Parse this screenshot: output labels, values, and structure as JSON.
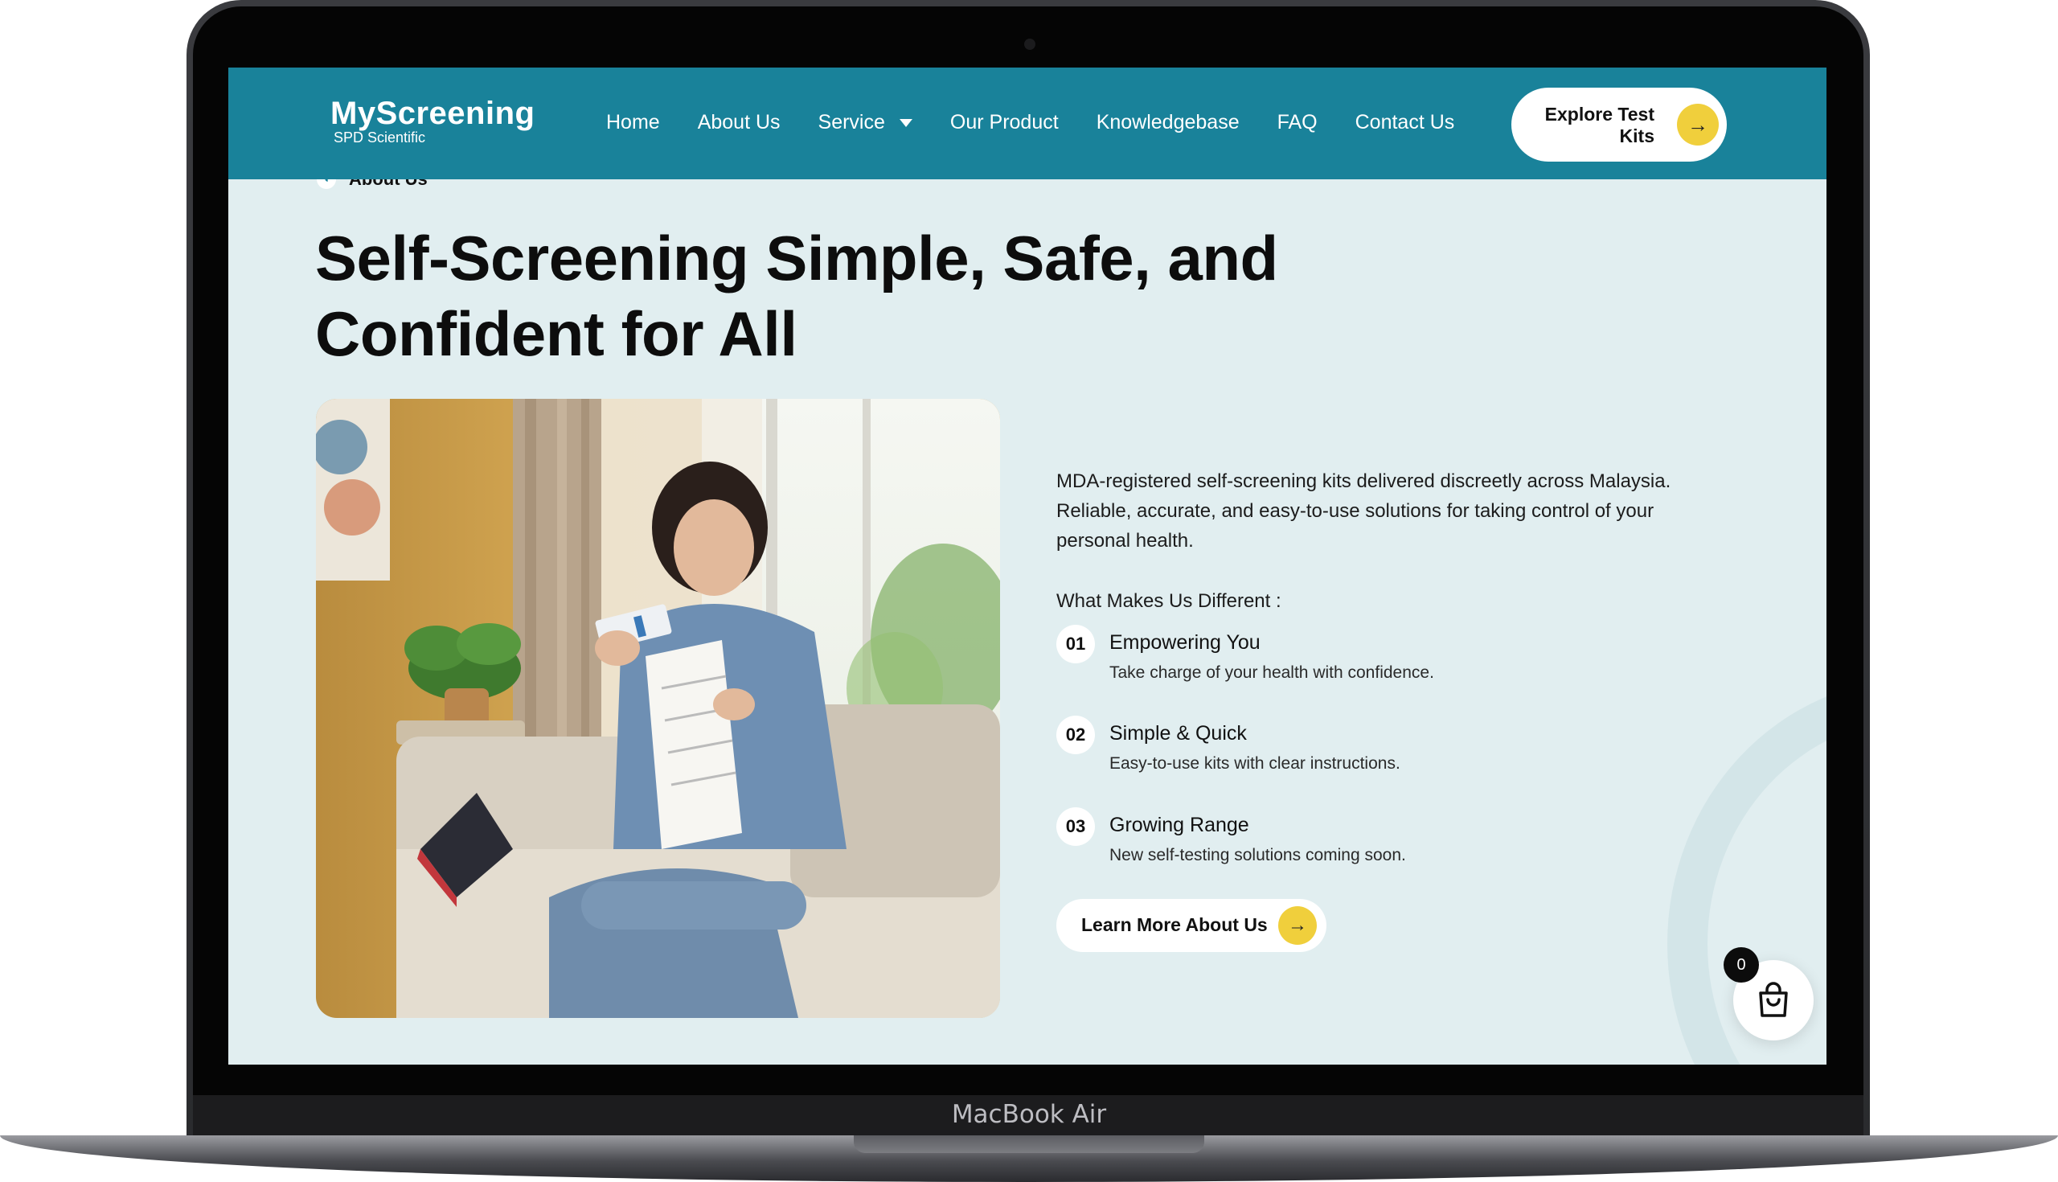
{
  "device": {
    "label": "MacBook Air"
  },
  "nav": {
    "logo_name": "MyScreening",
    "logo_sub": "SPD Scientific",
    "items": [
      "Home",
      "About Us",
      "Service",
      "Our Product",
      "Knowledgebase",
      "FAQ",
      "Contact Us"
    ],
    "cta_label": "Explore Test Kits"
  },
  "hero": {
    "eyebrow": "About Us",
    "headline": "Self-Screening Simple, Safe, and Confident for All",
    "description": "MDA-registered self-screening kits delivered discreetly across Malaysia. Reliable, accurate, and easy-to-use solutions for taking control of your personal health.",
    "different_title": "What Makes Us Different :",
    "features": [
      {
        "number": "01",
        "title": "Empowering You",
        "desc": "Take charge of your health with confidence."
      },
      {
        "number": "02",
        "title": "Simple & Quick",
        "desc": "Easy-to-use kits with clear instructions."
      },
      {
        "number": "03",
        "title": "Growing Range",
        "desc": "New self-testing solutions coming soon."
      }
    ],
    "learn_more": "Learn More About Us"
  },
  "cart": {
    "count": "0"
  },
  "colors": {
    "nav": "#19829a",
    "page_bg": "#e1eef0",
    "accent": "#f0cf3c"
  },
  "icons": {
    "cta_arrow": "arrow-right-icon",
    "cart": "shopping-bag-icon",
    "dropdown": "caret-down-icon"
  }
}
